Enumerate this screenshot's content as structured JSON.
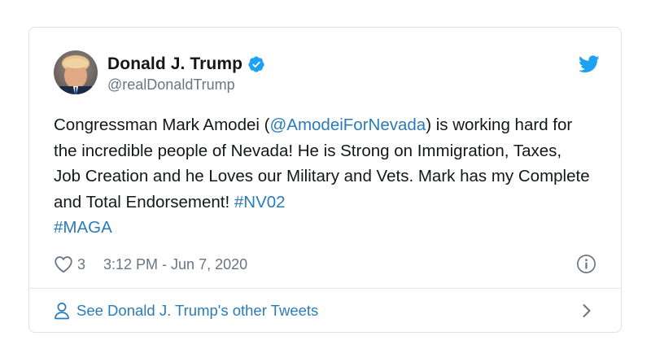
{
  "tweet": {
    "display_name": "Donald J. Trump",
    "handle": "@realDonaldTrump",
    "text_before_mention": "Congressman Mark Amodei (",
    "mention": "@AmodeiForNevada",
    "text_after_mention": ") is working hard for the incredible people of Nevada! He is Strong on Immigration, Taxes, Job Creation and he Loves our Military and Vets. Mark has my Complete and Total Endorsement! ",
    "hashtags": [
      "#NV02",
      "#MAGA"
    ],
    "like_count": "3",
    "timestamp": "3:12 PM - Jun 7, 2020",
    "footer_link": "See Donald J. Trump's other Tweets"
  },
  "icons": {
    "avatar": "profile-photo",
    "verified": "verified-badge-icon",
    "brand": "twitter-bird-icon",
    "like": "heart-icon",
    "info": "info-icon",
    "profile": "person-icon",
    "chevron": "chevron-right-icon"
  },
  "colors": {
    "link": "#2b7bb9",
    "verified": "#1da1f2",
    "brand": "#1da1f2",
    "muted": "#687684",
    "text": "#14171a"
  }
}
